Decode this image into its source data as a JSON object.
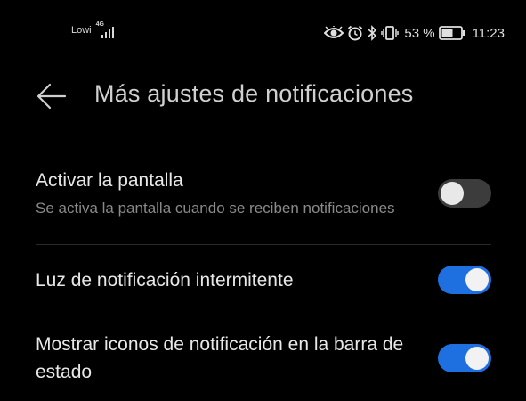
{
  "status_bar": {
    "carrier": "Lowi",
    "network_type": "4G",
    "battery_percent": "53 %",
    "time": "11:23",
    "icons": [
      "eye-comfort-icon",
      "alarm-icon",
      "bluetooth-icon",
      "vibrate-icon",
      "battery-icon"
    ]
  },
  "header": {
    "back_icon": "arrow-left-icon",
    "title": "Más ajustes de notificaciones"
  },
  "settings": [
    {
      "title": "Activar la pantalla",
      "description": "Se activa la pantalla cuando se reciben notificaciones",
      "enabled": false
    },
    {
      "title": "Luz de notificación intermitente",
      "description": "",
      "enabled": true
    },
    {
      "title": "Mostrar iconos de notificación en la barra de estado",
      "description": "",
      "enabled": true
    }
  ],
  "colors": {
    "background": "#000000",
    "toggle_on": "#1e6fe0",
    "toggle_off": "#3c3c3c",
    "text_primary": "#e8e8e8",
    "text_secondary": "#8a8a8a"
  }
}
